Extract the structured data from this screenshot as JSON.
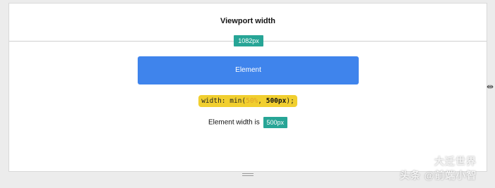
{
  "viewport": {
    "title": "Viewport width",
    "width_badge": "1082px"
  },
  "element": {
    "label": "Element"
  },
  "css": {
    "prefix": "width: min(",
    "percent": "50%",
    "separator": ", ",
    "px": "500px",
    "suffix": ");"
  },
  "element_width": {
    "label": "Element width is",
    "value": "500px"
  },
  "icons": {
    "resize_bottom": "drag-handle-icon",
    "resize_side": "resize-horizontal-icon"
  },
  "watermark": {
    "line1": "大迁世界",
    "line2": "头条 @前端小智"
  },
  "colors": {
    "accent_teal": "#27a596",
    "element_blue": "#3f84ec",
    "code_yellow": "#f1cf2f"
  }
}
